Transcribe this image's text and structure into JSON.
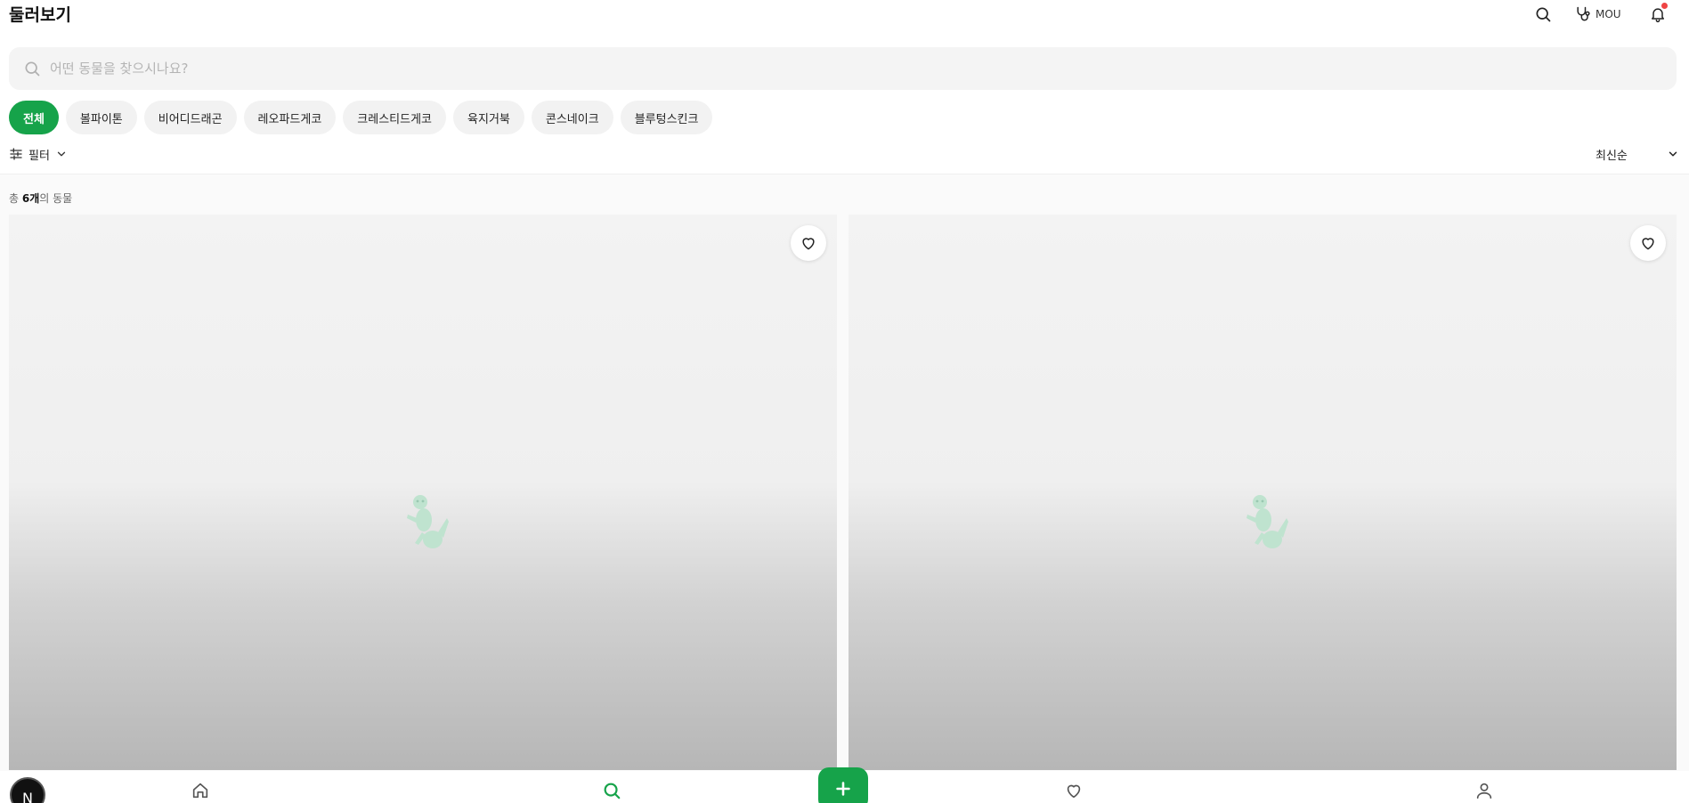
{
  "header": {
    "title": "둘러보기",
    "search_icon": "search-icon",
    "vet_label": "MOU",
    "vet_icon": "stethoscope-icon",
    "bell_icon": "bell-icon",
    "notification_color": "#ef4444"
  },
  "search": {
    "placeholder": "어떤 동물을 찾으시나요?",
    "value": ""
  },
  "categories": [
    {
      "label": "전체",
      "active": true
    },
    {
      "label": "볼파이톤",
      "active": false
    },
    {
      "label": "비어디드래곤",
      "active": false
    },
    {
      "label": "레오파드게코",
      "active": false
    },
    {
      "label": "크레스티드게코",
      "active": false
    },
    {
      "label": "육지거북",
      "active": false
    },
    {
      "label": "콘스네이크",
      "active": false
    },
    {
      "label": "블루텅스킨크",
      "active": false
    }
  ],
  "filter": {
    "label": "필터",
    "icon": "sliders-icon"
  },
  "sort": {
    "selected": "최신순"
  },
  "results": {
    "prefix": "총 ",
    "count": "6개",
    "suffix": "의 동물"
  },
  "cards": [
    {
      "favorite_icon": "heart-icon",
      "image_icon": "lizard-icon"
    },
    {
      "favorite_icon": "heart-icon",
      "image_icon": "lizard-icon"
    }
  ],
  "bottom_nav": {
    "avatar_letter": "N",
    "items": [
      "home-icon",
      "search-icon",
      "plus-icon",
      "heart-icon",
      "user-icon"
    ],
    "active": "search-icon"
  },
  "colors": {
    "accent": "#16a34a",
    "chip_bg": "#f2f2f2",
    "notification": "#ef4444"
  }
}
